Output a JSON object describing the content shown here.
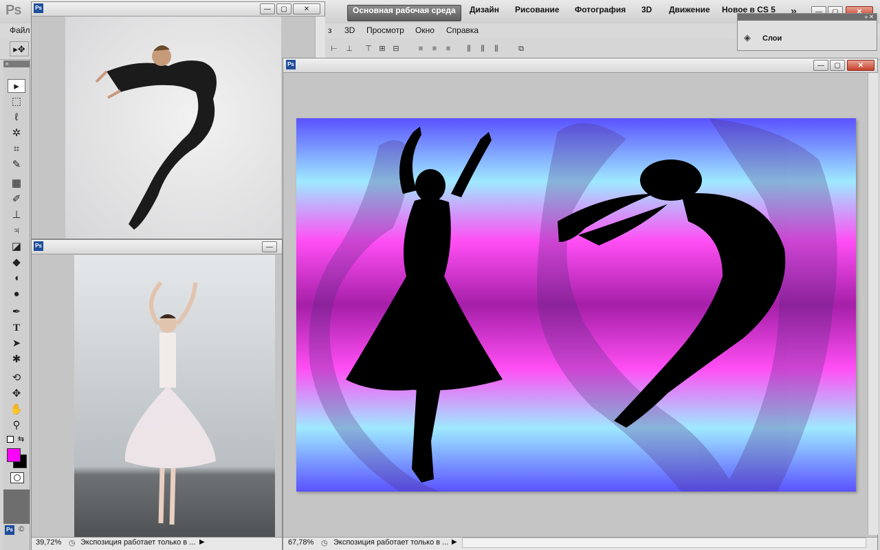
{
  "app": {
    "logo": "Ps",
    "workspaces": [
      {
        "label": "Основная рабочая среда",
        "active": true
      },
      {
        "label": "Дизайн"
      },
      {
        "label": "Рисование"
      },
      {
        "label": "Фотография"
      },
      {
        "label": "3D"
      },
      {
        "label": "Движение"
      },
      {
        "label": "Новое в CS 5"
      }
    ],
    "overflow_glyph": "»"
  },
  "menu": [
    "Файл",
    "з",
    "3D",
    "Просмотр",
    "Окно",
    "Справка"
  ],
  "tools": {
    "foreground_color": "#ff00ff",
    "background_color": "#000000"
  },
  "layers_panel": {
    "label": "Слои"
  },
  "documents": [
    {
      "id": "dancer-jump",
      "badge": "Ps"
    },
    {
      "id": "ballerina",
      "badge": "Ps",
      "zoom": "39,72%",
      "status": "Экспозиция работает только в ..."
    },
    {
      "id": "composite",
      "badge": "Ps",
      "zoom": "67,78%",
      "status": "Экспозиция работает только в ..."
    }
  ],
  "canvas_gradient": [
    "#5a52ff",
    "#9fe9ff",
    "#ff4ef4",
    "#a51fa8",
    "#ff4ef4",
    "#9fe9ff",
    "#5a52ff"
  ],
  "copyright_glyph": "©"
}
